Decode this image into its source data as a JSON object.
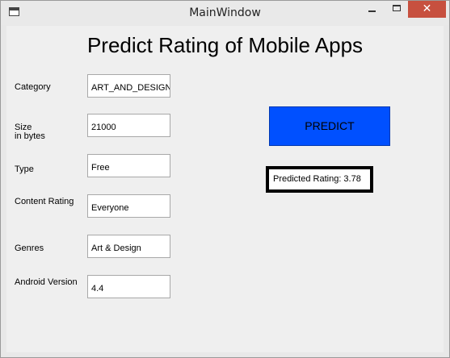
{
  "window": {
    "title": "MainWindow",
    "close_glyph": "✕",
    "controls": [
      "minimize-icon",
      "maximize-icon",
      "close-icon"
    ]
  },
  "form": {
    "heading": "Predict Rating of Mobile Apps",
    "fields": [
      {
        "label": "Category",
        "value": "ART_AND_DESIGN"
      },
      {
        "label": "Size\nin bytes",
        "value": "21000"
      },
      {
        "label": "Type",
        "value": "Free"
      },
      {
        "label": "Content Rating",
        "value": "Everyone"
      },
      {
        "label": "Genres",
        "value": "Art & Design"
      },
      {
        "label": "Android Version",
        "value": "4.4"
      }
    ],
    "predict_label": "PREDICT",
    "result_text": "Predicted Rating: 3.78"
  },
  "colors": {
    "predict_button": "#0050ff",
    "close_button": "#c7503f"
  }
}
